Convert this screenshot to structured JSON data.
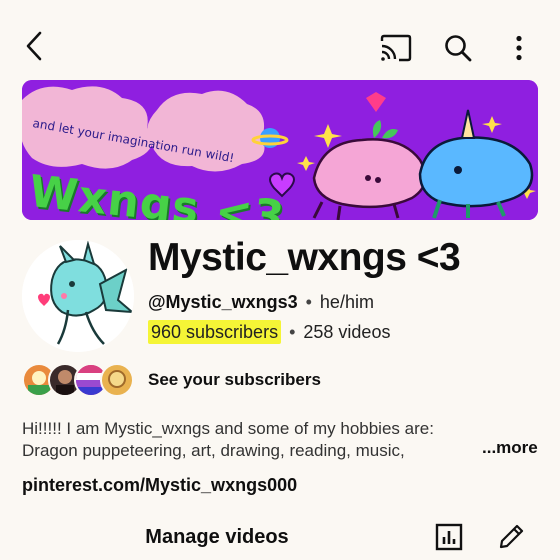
{
  "banner": {
    "tagline": "and let your imagination run wild!",
    "handle_art": "Wxngs <3"
  },
  "channel": {
    "name": "Mystic_wxngs <3",
    "handle": "@Mystic_wxngs3",
    "pronouns": "he/him",
    "subscribers": "960 subscribers",
    "videos": "258 videos",
    "separator": "•"
  },
  "subscribers_row": {
    "label": "See your subscribers",
    "avatar_colors": [
      "#e98a3c",
      "#3a2a2a",
      "#d94080",
      "#e9b24f"
    ]
  },
  "description": {
    "line1": "Hi!!!!! I am Mystic_wxngs and some of my hobbies are:",
    "line2": "Dragon puppeteering, art, drawing, reading, music,",
    "more_label": "...more"
  },
  "link": "pinterest.com/Mystic_wxngs000",
  "actions": {
    "manage_label": "Manage videos"
  },
  "icons": {
    "back": "back-arrow-icon",
    "cast": "cast-icon",
    "search": "search-icon",
    "more": "more-vert-icon",
    "analytics": "analytics-icon",
    "edit": "edit-pencil-icon"
  },
  "colors": {
    "background": "#fbf8f3",
    "banner": "#8f1fe0",
    "highlight": "#f5f536"
  }
}
